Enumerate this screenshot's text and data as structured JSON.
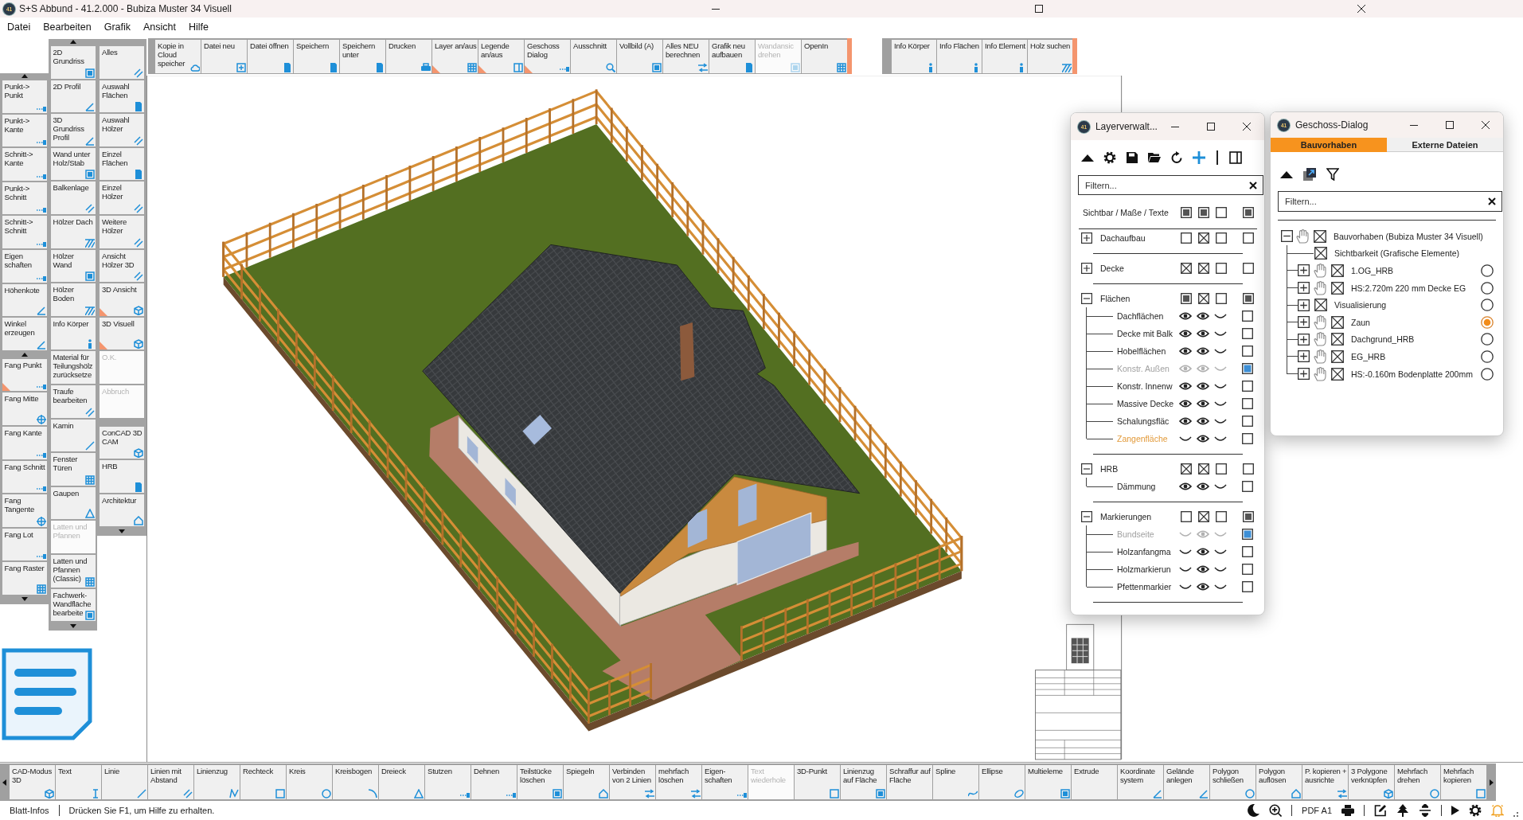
{
  "window": {
    "icon_text": "41",
    "title": "S+S Abbund - 41.2.000 - Bubiza Muster 34 Visuell"
  },
  "menu": [
    "Datei",
    "Bearbeiten",
    "Grafik",
    "Ansicht",
    "Hilfe"
  ],
  "top_toolbar": [
    {
      "label": "Kopie in Cloud speicher",
      "disabled": false,
      "flagged": false
    },
    {
      "label": "Datei neu",
      "disabled": false,
      "flagged": false
    },
    {
      "label": "Datei öffnen",
      "disabled": false,
      "flagged": false
    },
    {
      "label": "Speichern",
      "disabled": false,
      "flagged": false
    },
    {
      "label": "Speichern unter",
      "disabled": false,
      "flagged": false
    },
    {
      "label": "Drucken",
      "disabled": false,
      "flagged": false
    },
    {
      "label": "Layer an/aus",
      "disabled": false,
      "flagged": true
    },
    {
      "label": "Legende an/aus",
      "disabled": false,
      "flagged": true
    },
    {
      "label": "Geschoss Dialog",
      "disabled": false,
      "flagged": true
    },
    {
      "label": "Ausschnitt",
      "disabled": false,
      "flagged": false
    },
    {
      "label": "Vollbild (A)",
      "disabled": false,
      "flagged": false
    },
    {
      "label": "Alles NEU berechnen",
      "disabled": false,
      "flagged": false
    },
    {
      "label": "Grafik neu aufbauen",
      "disabled": false,
      "flagged": false
    },
    {
      "label": "Wandansic drehen",
      "disabled": true,
      "flagged": false
    },
    {
      "label": "OpenIn",
      "disabled": false,
      "flagged": false
    }
  ],
  "info_toolbar": [
    {
      "label": "Info Körper",
      "disabled": false,
      "flagged": false
    },
    {
      "label": "Info Flächen",
      "disabled": false,
      "flagged": false
    },
    {
      "label": "Info Element",
      "disabled": false,
      "flagged": false
    },
    {
      "label": "Holz suchen",
      "disabled": false,
      "flagged": false
    }
  ],
  "tool_columns": [
    {
      "groups": [
        [
          {
            "label": "Punkt-> Punkt",
            "disabled": false,
            "flagged": false
          },
          {
            "label": "Punkt-> Kante",
            "disabled": false,
            "flagged": false
          },
          {
            "label": "Schnitt-> Kante",
            "disabled": false,
            "flagged": false
          },
          {
            "label": "Punkt-> Schnitt",
            "disabled": false,
            "flagged": false
          },
          {
            "label": "Schnitt-> Schnitt",
            "disabled": false,
            "flagged": false
          },
          {
            "label": "Eigen schaften",
            "disabled": false,
            "flagged": false
          },
          {
            "label": "Höhenkote",
            "disabled": false,
            "flagged": false
          },
          {
            "label": "Winkel erzeugen",
            "disabled": false,
            "flagged": false
          }
        ],
        [
          {
            "label": "Fang Punkt",
            "disabled": false,
            "flagged": true
          },
          {
            "label": "Fang Mitte",
            "disabled": false,
            "flagged": false
          },
          {
            "label": "Fang Kante",
            "disabled": false,
            "flagged": false
          },
          {
            "label": "Fang Schnitt",
            "disabled": false,
            "flagged": false
          },
          {
            "label": "Fang Tangente",
            "disabled": false,
            "flagged": false
          },
          {
            "label": "Fang Lot",
            "disabled": false,
            "flagged": false
          },
          {
            "label": "Fang Raster",
            "disabled": false,
            "flagged": false
          }
        ]
      ]
    },
    {
      "groups": [
        [
          {
            "label": "2D Grundriss",
            "disabled": false,
            "flagged": false
          },
          {
            "label": "2D Profil",
            "disabled": false,
            "flagged": false
          },
          {
            "label": "3D Grundriss Profil",
            "disabled": false,
            "flagged": false
          },
          {
            "label": "Wand unter Holz/Stab",
            "disabled": false,
            "flagged": false
          },
          {
            "label": "Balkenlage",
            "disabled": false,
            "flagged": false
          },
          {
            "label": "Hölzer Dach",
            "disabled": false,
            "flagged": false
          },
          {
            "label": "Hölzer Wand",
            "disabled": false,
            "flagged": false
          },
          {
            "label": "Hölzer Boden",
            "disabled": false,
            "flagged": false
          },
          {
            "label": "Info Körper",
            "disabled": false,
            "flagged": false
          },
          {
            "label": "Material für Teilungshölz zurücksetze",
            "disabled": false,
            "flagged": false
          },
          {
            "label": "Traufe bearbeiten",
            "disabled": false,
            "flagged": false
          },
          {
            "label": "Kamin",
            "disabled": false,
            "flagged": false
          },
          {
            "label": "Fenster Türen",
            "disabled": false,
            "flagged": false
          },
          {
            "label": "Gaupen",
            "disabled": false,
            "flagged": false
          },
          {
            "label": "Latten und Pfannen",
            "disabled": true,
            "flagged": false
          },
          {
            "label": "Latten und Pfannen (Classic)",
            "disabled": false,
            "flagged": false
          },
          {
            "label": "Fachwerk-Wandfläche bearbeite",
            "disabled": false,
            "flagged": false
          }
        ]
      ]
    },
    {
      "groups": [
        [
          {
            "label": "Alles",
            "disabled": false,
            "flagged": false
          },
          {
            "label": "Auswahl Flächen",
            "disabled": false,
            "flagged": false
          },
          {
            "label": "Auswahl Hölzer",
            "disabled": false,
            "flagged": false
          },
          {
            "label": "Einzel Flächen",
            "disabled": false,
            "flagged": false
          },
          {
            "label": "Einzel Hölzer",
            "disabled": false,
            "flagged": false
          },
          {
            "label": "Weitere Hölzer",
            "disabled": false,
            "flagged": false
          },
          {
            "label": "Ansicht Hölzer 3D",
            "disabled": false,
            "flagged": false
          },
          {
            "label": "3D Ansicht",
            "disabled": false,
            "flagged": true
          },
          {
            "label": "3D Visuell",
            "disabled": false,
            "flagged": true
          },
          {
            "label": "O.K.",
            "disabled": true,
            "flagged": false
          },
          {
            "label": "Abbruch",
            "disabled": true,
            "flagged": false
          }
        ],
        [
          {
            "label": "ConCAD 3D CAM",
            "disabled": false,
            "flagged": false
          },
          {
            "label": "HRB",
            "disabled": false,
            "flagged": false
          },
          {
            "label": "Architektur",
            "disabled": false,
            "flagged": false
          }
        ]
      ]
    }
  ],
  "layer_dialog": {
    "icon_text": "41",
    "title": "Layerverwalt...",
    "filter": {
      "placeholder": "Filtern..."
    },
    "header": {
      "label": "Sichtbar / Maße / Texte",
      "boxes": [
        {
          "kind": "filled"
        },
        {
          "kind": "filled"
        },
        {
          "kind": "empty"
        },
        {
          "kind": "filled"
        }
      ]
    },
    "groups": [
      {
        "label": "Dachaufbau",
        "expanded": false,
        "boxes": [
          {
            "kind": "empty"
          },
          {
            "kind": "crossed"
          },
          {
            "kind": "empty"
          },
          {
            "kind": "empty"
          }
        ]
      },
      {
        "label": "Decke",
        "expanded": false,
        "boxes": [
          {
            "kind": "crossed"
          },
          {
            "kind": "crossed"
          },
          {
            "kind": "empty"
          },
          {
            "kind": "empty"
          }
        ]
      },
      {
        "label": "Flächen",
        "expanded": true,
        "boxes": [
          {
            "kind": "filled"
          },
          {
            "kind": "crossed"
          },
          {
            "kind": "empty"
          },
          {
            "kind": "filled"
          }
        ],
        "children": [
          {
            "label": "Dachflächen",
            "disabled": false,
            "current": false,
            "eyes": [
              {
                "open": true
              },
              {
                "open": true
              },
              {
                "open": false
              }
            ],
            "marked": false
          },
          {
            "label": "Decke mit Balk",
            "disabled": false,
            "current": false,
            "eyes": [
              {
                "open": true
              },
              {
                "open": true
              },
              {
                "open": false
              }
            ],
            "marked": false
          },
          {
            "label": "Hobelflächen",
            "disabled": false,
            "current": false,
            "eyes": [
              {
                "open": true
              },
              {
                "open": true
              },
              {
                "open": false
              }
            ],
            "marked": false
          },
          {
            "label": "Konstr. Außen",
            "disabled": true,
            "current": false,
            "eyes": [
              {
                "open": true
              },
              {
                "open": true
              },
              {
                "open": false
              }
            ],
            "marked": true
          },
          {
            "label": "Konstr. Innenw",
            "disabled": false,
            "current": false,
            "eyes": [
              {
                "open": true
              },
              {
                "open": true
              },
              {
                "open": false
              }
            ],
            "marked": false
          },
          {
            "label": "Massive Decke",
            "disabled": false,
            "current": false,
            "eyes": [
              {
                "open": true
              },
              {
                "open": true
              },
              {
                "open": false
              }
            ],
            "marked": false
          },
          {
            "label": "Schalungsfläc",
            "disabled": false,
            "current": false,
            "eyes": [
              {
                "open": true
              },
              {
                "open": true
              },
              {
                "open": false
              }
            ],
            "marked": false
          },
          {
            "label": "Zangenfläche",
            "disabled": false,
            "current": true,
            "eyes": [
              {
                "open": false
              },
              {
                "open": true
              },
              {
                "open": false
              }
            ],
            "marked": false
          }
        ]
      },
      {
        "label": "HRB",
        "expanded": true,
        "boxes": [
          {
            "kind": "crossed"
          },
          {
            "kind": "crossed"
          },
          {
            "kind": "empty"
          },
          {
            "kind": "empty"
          }
        ],
        "children": [
          {
            "label": "Dämmung",
            "disabled": false,
            "current": false,
            "eyes": [
              {
                "open": true
              },
              {
                "open": true
              },
              {
                "open": false
              }
            ],
            "marked": false
          }
        ]
      },
      {
        "label": "Markierungen",
        "expanded": true,
        "boxes": [
          {
            "kind": "empty"
          },
          {
            "kind": "crossed"
          },
          {
            "kind": "empty"
          },
          {
            "kind": "filled"
          }
        ],
        "children": [
          {
            "label": "Bundseite",
            "disabled": true,
            "current": false,
            "eyes": [
              {
                "open": false
              },
              {
                "open": true
              },
              {
                "open": false
              }
            ],
            "marked": true
          },
          {
            "label": "Holzanfangma",
            "disabled": false,
            "current": false,
            "eyes": [
              {
                "open": false
              },
              {
                "open": true
              },
              {
                "open": false
              }
            ],
            "marked": false
          },
          {
            "label": "Holzmarkierun",
            "disabled": false,
            "current": false,
            "eyes": [
              {
                "open": false
              },
              {
                "open": true
              },
              {
                "open": false
              }
            ],
            "marked": false
          },
          {
            "label": "Pfettenmarkier",
            "disabled": false,
            "current": false,
            "eyes": [
              {
                "open": false
              },
              {
                "open": true
              },
              {
                "open": false
              }
            ],
            "marked": false
          }
        ]
      }
    ]
  },
  "geschoss_dialog": {
    "icon_text": "41",
    "title": "Geschoss-Dialog",
    "tabs": [
      {
        "label": "Bauvorhaben",
        "selected": true
      },
      {
        "label": "Externe Dateien",
        "selected": false
      }
    ],
    "filter": {
      "placeholder": "Filtern..."
    },
    "tree": [
      {
        "kind": "project",
        "label": "Bauvorhaben (Bubiza Muster 34 Visuell)",
        "expanded": true,
        "hand": true,
        "checked": true,
        "children": [
          {
            "kind": "visibility",
            "label": "Sichtbarkeit (Grafische Elemente)",
            "checked": true
          },
          {
            "kind": "level",
            "label": "1.OG_HRB",
            "expanded": false,
            "hand": true,
            "checked": true,
            "selected": false
          },
          {
            "kind": "level",
            "label": "HS:2.720m 220 mm Decke EG",
            "expanded": false,
            "hand": true,
            "checked": true,
            "selected": false
          },
          {
            "kind": "level",
            "label": "Visualisierung",
            "expanded": false,
            "hand": false,
            "checked": true,
            "selected": false
          },
          {
            "kind": "level",
            "label": "Zaun",
            "expanded": false,
            "hand": true,
            "checked": true,
            "selected": true
          },
          {
            "kind": "level",
            "label": "Dachgrund_HRB",
            "expanded": false,
            "hand": true,
            "checked": true,
            "selected": false
          },
          {
            "kind": "level",
            "label": "EG_HRB",
            "expanded": false,
            "hand": true,
            "checked": true,
            "selected": false
          },
          {
            "kind": "level",
            "label": "HS:-0.160m Bodenplatte 200mm",
            "expanded": false,
            "hand": true,
            "checked": true,
            "selected": false
          }
        ]
      }
    ]
  },
  "bottom_toolbar": [
    {
      "label": "CAD-Modus 3D",
      "disabled": false
    },
    {
      "label": "Text",
      "disabled": false
    },
    {
      "label": "Linie",
      "disabled": false
    },
    {
      "label": "Linien mit Abstand",
      "disabled": false
    },
    {
      "label": "Linienzug",
      "disabled": false
    },
    {
      "label": "Rechteck",
      "disabled": false
    },
    {
      "label": "Kreis",
      "disabled": false
    },
    {
      "label": "Kreisbogen",
      "disabled": false
    },
    {
      "label": "Dreieck",
      "disabled": false
    },
    {
      "label": "Stutzen",
      "disabled": false
    },
    {
      "label": "Dehnen",
      "disabled": false
    },
    {
      "label": "Teilstücke löschen",
      "disabled": false
    },
    {
      "label": "Spiegeln",
      "disabled": false
    },
    {
      "label": "Verbinden von 2 Linien",
      "disabled": false
    },
    {
      "label": "mehrfach löschen",
      "disabled": false
    },
    {
      "label": "Eigen- schaften",
      "disabled": false
    },
    {
      "label": "Text wiederhole",
      "disabled": true
    },
    {
      "label": "3D-Punkt",
      "disabled": false
    },
    {
      "label": "Linienzug auf Fläche",
      "disabled": false
    },
    {
      "label": "Schraffur auf Fläche",
      "disabled": false
    },
    {
      "label": "Spline",
      "disabled": false
    },
    {
      "label": "Ellipse",
      "disabled": false
    },
    {
      "label": "Multieleme",
      "disabled": false
    },
    {
      "label": "Extrude",
      "disabled": false
    },
    {
      "label": "Koordinate system",
      "disabled": false
    },
    {
      "label": "Gelände anlegen",
      "disabled": false
    },
    {
      "label": "Polygon schließen",
      "disabled": false
    },
    {
      "label": "Polygon auflösen",
      "disabled": false
    },
    {
      "label": "P. kopieren + ausrichte",
      "disabled": false
    },
    {
      "label": "3 Polygone verknüpfen",
      "disabled": false
    },
    {
      "label": "Mehrfach drehen",
      "disabled": false
    },
    {
      "label": "Mehrfach kopieren",
      "disabled": false
    }
  ],
  "status_bar": {
    "sheet": "Blatt-Infos",
    "hint": "Drücken Sie F1, um Hilfe zu erhalten.",
    "output": "PDF A1"
  }
}
